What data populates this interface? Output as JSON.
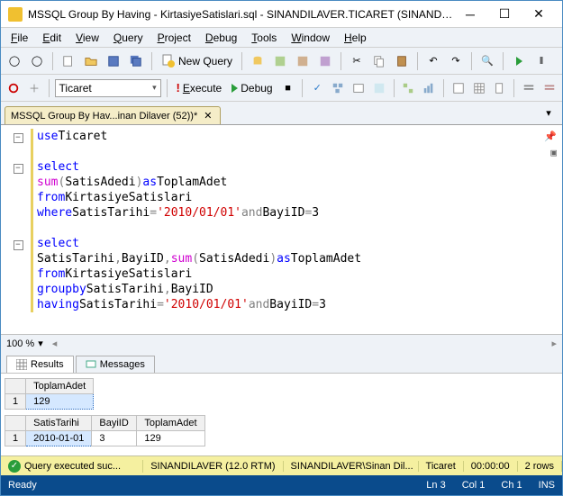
{
  "window": {
    "title": "MSSQL Group By Having - KirtasiyeSatislari.sql - SINANDILAVER.TICARET (SINANDILAV..."
  },
  "menu": {
    "file": "File",
    "edit": "Edit",
    "view": "View",
    "query": "Query",
    "project": "Project",
    "debug": "Debug",
    "tools": "Tools",
    "window": "Window",
    "help": "Help"
  },
  "toolbar": {
    "new_query": "New Query",
    "execute": "Execute",
    "debug": "Debug",
    "database": "Ticaret"
  },
  "tab": {
    "label": "MSSQL Group By Hav...inan Dilaver (52))*"
  },
  "code": {
    "l1": "use",
    "l1b": " Ticaret",
    "l3": "select",
    "l4a": "sum",
    "l4b": "SatisAdedi",
    "l4c": " as",
    "l4d": " ToplamAdet",
    "l5a": "from",
    "l5b": " KirtasiyeSatislari",
    "l6a": "where",
    "l6b": " SatisTarihi ",
    "l6c": "=",
    "l6d": "'2010/01/01'",
    "l6e": " and",
    "l6f": " BayiID ",
    "l6g": "=",
    "l6h": " 3",
    "l8": "select",
    "l9a": "SatisTarihi",
    "l9b": " BayiID",
    "l9c": "sum",
    "l9d": "SatisAdedi",
    "l9e": " as",
    "l9f": " ToplamAdet",
    "l10a": "from",
    "l10b": " KirtasiyeSatislari",
    "l11a": "group",
    "l11b": " by",
    "l11c": " SatisTarihi",
    "l11d": " BayiID",
    "l12a": "having",
    "l12b": " SatisTarihi ",
    "l12c": "=",
    "l12d": "'2010/01/01'",
    "l12e": " and",
    "l12f": " BayiID ",
    "l12g": "=",
    "l12h": " 3"
  },
  "zoom": "100 %",
  "results": {
    "tab1": "Results",
    "tab2": "Messages",
    "grid1": {
      "headers": [
        "ToplamAdet"
      ],
      "rows": [
        [
          "129"
        ]
      ]
    },
    "grid2": {
      "headers": [
        "SatisTarihi",
        "BayiID",
        "ToplamAdet"
      ],
      "rows": [
        [
          "2010-01-01",
          "3",
          "129"
        ]
      ]
    }
  },
  "status": {
    "msg": "Query executed suc...",
    "server": "SINANDILAVER (12.0 RTM)",
    "user": "SINANDILAVER\\Sinan Dil...",
    "db": "Ticaret",
    "time": "00:00:00",
    "rows": "2 rows"
  },
  "footer": {
    "ready": "Ready",
    "ln": "Ln 3",
    "col": "Col 1",
    "ch": "Ch 1",
    "ins": "INS"
  }
}
